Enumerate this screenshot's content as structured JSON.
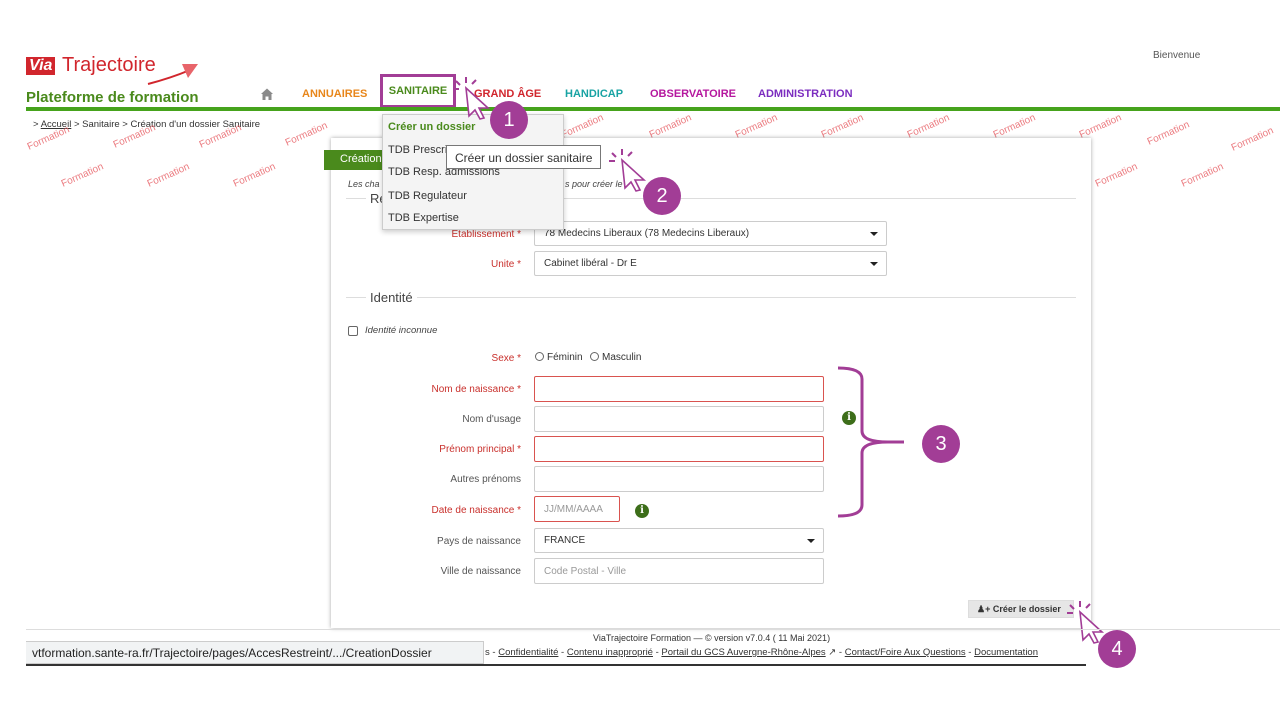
{
  "header": {
    "logo_via": "Via",
    "logo_traj": "Trajectoire",
    "platform_title": "Plateforme de formation",
    "welcome": "Bienvenue"
  },
  "nav": {
    "items": [
      {
        "label": "ANNUAIRES",
        "color": "#e8861a"
      },
      {
        "label": "SANITAIRE",
        "color": "#4a8a1c"
      },
      {
        "label": "GRAND ÂGE",
        "color": "#d1262d"
      },
      {
        "label": "HANDICAP",
        "color": "#18a3a3"
      },
      {
        "label": "OBSERVATOIRE",
        "color": "#b5179e"
      },
      {
        "label": "ADMINISTRATION",
        "color": "#7b2cbf"
      }
    ]
  },
  "breadcrumb": {
    "prefix": ">",
    "home": "Accueil",
    "rest": "> Sanitaire > Création d'un dossier Sanitaire"
  },
  "watermark": "Formation",
  "dropdown": {
    "items": [
      "Créer un dossier",
      "TDB Prescri",
      "TDB Resp. admissions",
      "TDB Regulateur",
      "TDB Expertise"
    ]
  },
  "tooltip": "Créer un dossier sanitaire",
  "form": {
    "tab_label": "Création",
    "hint_left": "Les cha",
    "hint_right": "s pour créer le",
    "section_resp": "Re",
    "etablissement_label": "Etablissement *",
    "etablissement_value": "78 Medecins Liberaux (78 Medecins Liberaux)",
    "unite_label": "Unite *",
    "unite_value": "Cabinet libéral - Dr E",
    "section_identite": "Identité",
    "identite_inconnue": "Identité inconnue",
    "sexe_label": "Sexe *",
    "sexe_f": "Féminin",
    "sexe_m": "Masculin",
    "nom_naissance": "Nom de naissance *",
    "nom_usage": "Nom d'usage",
    "prenom_principal": "Prénom principal *",
    "autres_prenoms": "Autres prénoms",
    "date_naissance": "Date de naissance *",
    "date_placeholder": "JJ/MM/AAAA",
    "pays_label": "Pays de naissance",
    "pays_value": "FRANCE",
    "ville_label": "Ville de naissance",
    "ville_placeholder": "Code Postal - Ville",
    "create_button": "Créer le dossier",
    "info_glyph": "i"
  },
  "callouts": [
    "1",
    "2",
    "3",
    "4"
  ],
  "footer": {
    "version": "ViaTrajectoire Formation — © version v7.0.4 ( 11 Mai 2021)",
    "links_prefix": "s -",
    "links": [
      "Confidentialité",
      "Contenu inapproprié",
      "Portail du GCS Auvergne-Rhône-Alpes",
      "Contact/Foire Aux Questions",
      "Documentation"
    ],
    "status_url": "vtformation.sante-ra.fr/Trajectoire/pages/AccesRestreint/.../CreationDossier"
  },
  "colors": {
    "accent_green": "#46a31c",
    "callout_purple": "#a23d96",
    "required_red": "#c9302c"
  }
}
